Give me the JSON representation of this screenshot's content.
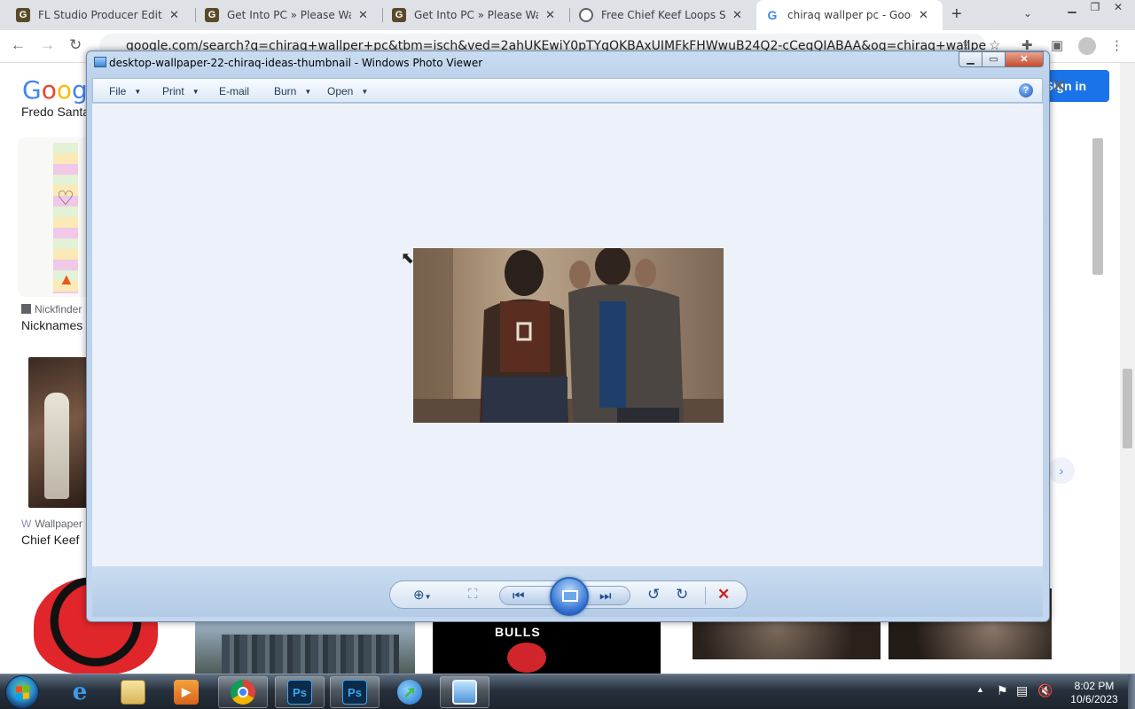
{
  "browser": {
    "tabs": [
      {
        "title": "FL Studio Producer Edition",
        "icon": "g-site-icon"
      },
      {
        "title": "Get Into PC » Please Wait F",
        "icon": "g-site-icon"
      },
      {
        "title": "Get Into PC » Please Wait F",
        "icon": "g-site-icon"
      },
      {
        "title": "Free Chief Keef Loops Samp",
        "icon": "globe-icon"
      },
      {
        "title": "chiraq wallper pc - Google",
        "icon": "google-icon"
      }
    ],
    "new_tab": "+",
    "tab_close": "✕",
    "url": "google.com/search?q=chiraq+wallper+pc&tbm=isch&ved=2ahUKEwiY0pTYgOKBAxUIMFkFHWwuB24Q2-cCegQIABAA&oq=chiraq+wallper+pc&gs..."
  },
  "google": {
    "logo_letters": [
      "G",
      "o",
      "o",
      "g"
    ],
    "signin_label": "Sign in",
    "results": [
      {
        "title": "Fredo Santa",
        "source": ""
      },
      {
        "title": "Nicknames",
        "source": "Nickfinder"
      },
      {
        "title": "Chief Keef",
        "source": "Wallpaper"
      }
    ],
    "close": "✕"
  },
  "photo_viewer": {
    "title": "desktop-wallpaper-22-chiraq-ideas-thumbnail - Windows Photo Viewer",
    "menus": [
      "File",
      "Print",
      "E-mail",
      "Burn",
      "Open"
    ],
    "help": "?",
    "controls": [
      "zoom",
      "actual-size",
      "previous",
      "slide-show",
      "next",
      "rotate-counterclockwise",
      "rotate-clockwise",
      "delete"
    ]
  },
  "taskbar": {
    "clock_time": "8:02 PM",
    "clock_date": "10/6/2023",
    "apps": [
      "ie",
      "explorer",
      "media-player",
      "chrome",
      "photoshop",
      "photoshop",
      "internet-download-manager",
      "photo-viewer"
    ]
  },
  "colors": {
    "taskbar": "#27313d",
    "pv_canvas": "#edf2fa",
    "google_blue": "#1a73e8",
    "close_red": "#c54b2c"
  }
}
